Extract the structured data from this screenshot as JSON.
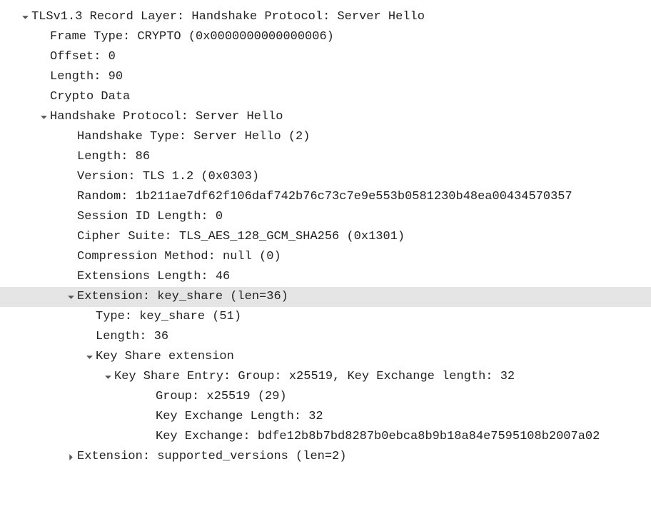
{
  "tree": {
    "record_layer": {
      "label": "TLSv1.3 Record Layer: Handshake Protocol: Server Hello",
      "frame_type": "Frame Type: CRYPTO (0x0000000000000006)",
      "offset": "Offset: 0",
      "length": "Length: 90",
      "crypto_data": "Crypto Data",
      "handshake": {
        "label": "Handshake Protocol: Server Hello",
        "handshake_type": "Handshake Type: Server Hello (2)",
        "length": "Length: 86",
        "version": "Version: TLS 1.2 (0x0303)",
        "random": "Random: 1b211ae7df62f106daf742b76c73c7e9e553b0581230b48ea00434570357",
        "session_id_length": "Session ID Length: 0",
        "cipher_suite": "Cipher Suite: TLS_AES_128_GCM_SHA256 (0x1301)",
        "compression_method": "Compression Method: null (0)",
        "extensions_length": "Extensions Length: 46",
        "ext_key_share": {
          "label": "Extension: key_share (len=36)",
          "type": "Type: key_share (51)",
          "length": "Length: 36",
          "kse": {
            "label": "Key Share extension",
            "entry": {
              "label": "Key Share Entry: Group: x25519, Key Exchange length: 32",
              "group": "Group: x25519 (29)",
              "key_exchange_length": "Key Exchange Length: 32",
              "key_exchange": "Key Exchange: bdfe12b8b7bd8287b0ebca8b9b18a84e7595108b2007a02"
            }
          }
        },
        "ext_supported_versions": {
          "label": "Extension: supported_versions (len=2)"
        }
      }
    }
  }
}
